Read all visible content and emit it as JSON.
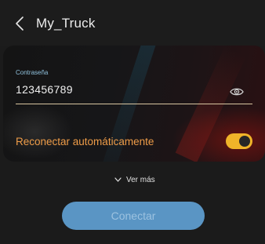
{
  "header": {
    "title": "My_Truck",
    "back_icon": "chevron-left-icon"
  },
  "form": {
    "password_label": "Contraseña",
    "password_value": "123456789",
    "show_password_icon": "eye-icon",
    "auto_reconnect_label": "Reconectar automáticamente",
    "auto_reconnect_enabled": true
  },
  "more": {
    "label": "Ver más",
    "icon": "chevron-down-icon"
  },
  "connect_button": {
    "label": "Conectar"
  },
  "colors": {
    "accent_orange": "#ee9c48",
    "toggle_on": "#f0b429",
    "button_blue": "#5a95c4",
    "label_blue": "#8fc0dc"
  }
}
